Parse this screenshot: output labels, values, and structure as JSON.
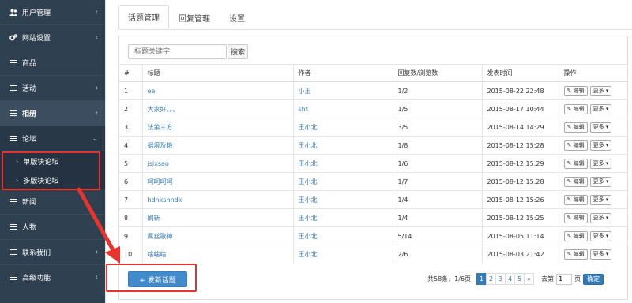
{
  "sidebar": {
    "items": [
      {
        "label": "用户管理",
        "icon": "users-icon",
        "chevron": "‹"
      },
      {
        "label": "网站设置",
        "icon": "cogs-icon",
        "chevron": "‹"
      },
      {
        "label": "商品",
        "icon": "bars-icon",
        "chevron": ""
      },
      {
        "label": "活动",
        "icon": "bars-icon",
        "chevron": "‹"
      },
      {
        "label": "相册",
        "icon": "bars-icon",
        "chevron": "‹"
      },
      {
        "label": "论坛",
        "icon": "bars-icon",
        "chevron": "⌄"
      },
      {
        "label": "新闻",
        "icon": "bars-icon",
        "chevron": ""
      },
      {
        "label": "人物",
        "icon": "bars-icon",
        "chevron": ""
      },
      {
        "label": "联系我们",
        "icon": "bars-icon",
        "chevron": "‹"
      },
      {
        "label": "高级功能",
        "icon": "bars-icon",
        "chevron": "‹"
      }
    ],
    "sub_items": [
      {
        "label": "单版块论坛"
      },
      {
        "label": "多版块论坛"
      }
    ]
  },
  "tabs": [
    {
      "label": "话题管理"
    },
    {
      "label": "回复管理"
    },
    {
      "label": "设置"
    }
  ],
  "search": {
    "placeholder": "标题关键字",
    "button": "搜索"
  },
  "table": {
    "headers": [
      "#",
      "标题",
      "作者",
      "回复数/浏览数",
      "发表时间",
      "操作"
    ],
    "edit_label": "✎ 编辑",
    "more_label": "更多 ▾",
    "rows": [
      {
        "id": "1",
        "title": "ee",
        "author": "小王",
        "replies": "1/2",
        "time": "2015-08-22 22:48"
      },
      {
        "id": "2",
        "title": "大家好。。。",
        "author": "sht",
        "replies": "1/5",
        "time": "2015-08-17 10:44"
      },
      {
        "id": "3",
        "title": "法第三方",
        "author": "王小北",
        "replies": "3/5",
        "time": "2015-08-14 14:29"
      },
      {
        "id": "4",
        "title": "据境及艳",
        "author": "王小北",
        "replies": "1/8",
        "time": "2015-08-12 15:28"
      },
      {
        "id": "5",
        "title": "jsjxsao",
        "author": "王小北",
        "replies": "1/6",
        "time": "2015-08-12 15:29"
      },
      {
        "id": "6",
        "title": "呵呵呵呵",
        "author": "王小北",
        "replies": "1/7",
        "time": "2015-08-12 15:28"
      },
      {
        "id": "7",
        "title": "hdnkshndk",
        "author": "王小北",
        "replies": "1/4",
        "time": "2015-08-12 15:26"
      },
      {
        "id": "8",
        "title": "刷新",
        "author": "王小北",
        "replies": "1/4",
        "time": "2015-08-12 15:25"
      },
      {
        "id": "9",
        "title": "屌丝歌神",
        "author": "王小北",
        "replies": "5/14",
        "time": "2015-08-05 11:14"
      },
      {
        "id": "10",
        "title": "啥啥啥",
        "author": "王小北",
        "replies": "2/6",
        "time": "2015-08-03 21:42"
      }
    ]
  },
  "footer": {
    "new_button": "+ 发新话题",
    "summary": "共58条，1/6页",
    "pages": [
      "1",
      "2",
      "3",
      "4",
      "5",
      "»"
    ],
    "goto_prefix": "去第",
    "goto_value": "1",
    "goto_suffix": "页",
    "confirm": "确定"
  },
  "colors": {
    "sidebar_bg": "#2f4050",
    "link": "#337ab7",
    "primary": "#428bca",
    "highlight": "#e8342c"
  }
}
